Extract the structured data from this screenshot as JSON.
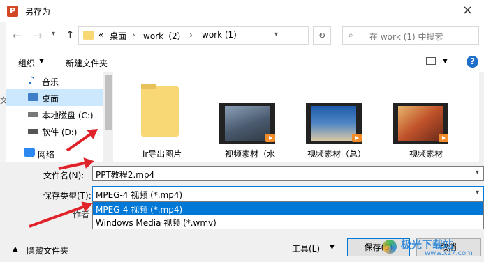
{
  "window": {
    "title": "另存为",
    "close_glyph": "×"
  },
  "address": {
    "crumbs": [
      "桌面",
      "work（2）",
      "work (1)"
    ],
    "overflow": "«",
    "search_placeholder": "在 work (1) 中搜索"
  },
  "toolbar": {
    "organize": "组织",
    "new_folder": "新建文件夹",
    "help": "?"
  },
  "sidebar": {
    "items": [
      {
        "label": "音乐",
        "icon": "music-note-icon"
      },
      {
        "label": "桌面",
        "icon": "desktop-icon",
        "selected": true
      },
      {
        "label": "本地磁盘 (C:)",
        "icon": "drive-c-icon"
      },
      {
        "label": "软件 (D:)",
        "icon": "drive-d-icon"
      },
      {
        "label": "网络",
        "icon": "network-icon"
      }
    ],
    "side_label": "文"
  },
  "files": [
    {
      "name": "lr导出图片",
      "kind": "folder"
    },
    {
      "name": "视频素材（水",
      "kind": "video",
      "colors": [
        "#4a5a6e",
        "#8aa0b8"
      ]
    },
    {
      "name": "视频素材（总）",
      "kind": "video",
      "colors": [
        "#1c5aa8",
        "#d9c8a6"
      ]
    },
    {
      "name": "视频素材",
      "kind": "video",
      "colors": [
        "#c0522a",
        "#e8b56b"
      ]
    }
  ],
  "form": {
    "filename_label": "文件名(N):",
    "filename_value": "PPT教程2.mp4",
    "type_label": "保存类型(T):",
    "type_value": "MPEG-4 视频 (*.mp4)",
    "author_label": "作者"
  },
  "dropdown": {
    "options": [
      "MPEG-4 视频 (*.mp4)",
      "Windows Media 视频 (*.wmv)"
    ],
    "selected_index": 0
  },
  "footer": {
    "hide_folders": "隐藏文件夹",
    "tools": "工具(L)",
    "save": "保存(S)",
    "cancel": "取消"
  },
  "watermark": {
    "site": "极光下载站",
    "url": "www.xz7.com"
  },
  "colors": {
    "accent": "#0078d7",
    "highlight": "#cce8ff",
    "arrow": "#e0232a",
    "folder": "#f8d775"
  }
}
